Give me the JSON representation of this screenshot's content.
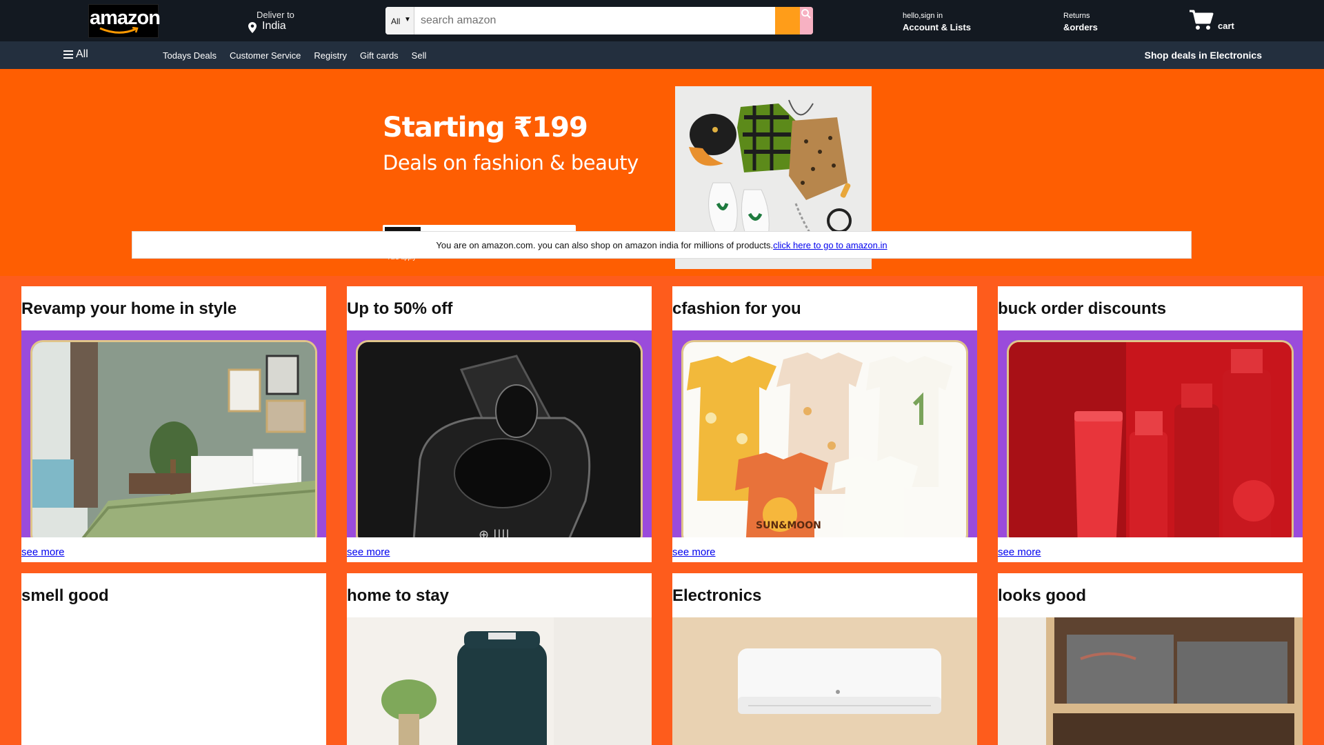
{
  "header": {
    "logo_text": "amazon",
    "deliver_label": "Deliver to",
    "deliver_country": "India",
    "search": {
      "category": "All",
      "placeholder": "search amazon"
    },
    "account": {
      "greeting": "hello,sign in",
      "label": "Account & Lists"
    },
    "returns": {
      "line1": "Returns",
      "line2": "&orders"
    },
    "cart_label": "cart"
  },
  "subnav": {
    "all_label": "All",
    "links": [
      "Todays Deals",
      "Customer Service",
      "Registry",
      "Gift cards",
      "Sell"
    ],
    "promo": "Shop deals in Electronics"
  },
  "hero": {
    "headline": "Starting ₹199",
    "subline": "Deals on fashion & beauty",
    "terms": "T&C apply"
  },
  "notice": {
    "text": "You are on amazon.com. you can also shop on amazon india for millions of products.",
    "link": "click here to go to amazon.in"
  },
  "cards": [
    {
      "title": "Revamp your home in style",
      "link": "see more"
    },
    {
      "title": "Up to 50% off",
      "link": "see more"
    },
    {
      "title": "cfashion for you",
      "link": "see more"
    },
    {
      "title": "buck order discounts",
      "link": "see more"
    },
    {
      "title": "smell good"
    },
    {
      "title": "home to stay"
    },
    {
      "title": "Electronics"
    },
    {
      "title": "looks good"
    }
  ],
  "colors": {
    "nav_bg": "#131921",
    "subnav_bg": "#232f3e",
    "page_bg": "#fe5c1c",
    "search_button": "#ff9d19",
    "card_frame": "#9a4bdb"
  }
}
